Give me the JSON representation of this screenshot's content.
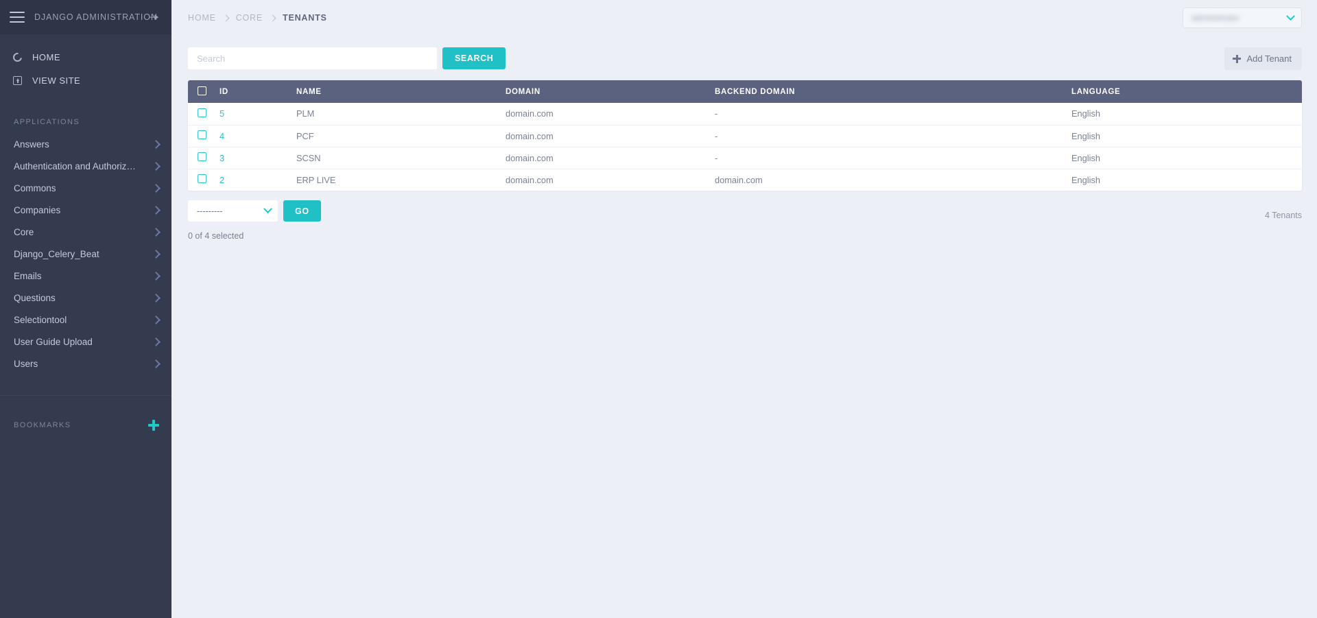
{
  "sidebar": {
    "brand_title": "DJANGO ADMINISTRATION",
    "hamburger_icon": "hamburger-menu-icon",
    "pin_icon": "pin-icon",
    "nav": [
      {
        "label": "HOME",
        "icon": "home-ring-icon"
      },
      {
        "label": "VIEW SITE",
        "icon": "external-link-box-icon"
      }
    ],
    "applications_title": "APPLICATIONS",
    "applications": [
      {
        "label": "Answers"
      },
      {
        "label": "Authentication and Authoriz…"
      },
      {
        "label": "Commons"
      },
      {
        "label": "Companies"
      },
      {
        "label": "Core"
      },
      {
        "label": "Django_Celery_Beat"
      },
      {
        "label": "Emails"
      },
      {
        "label": "Questions"
      },
      {
        "label": "Selectiontool"
      },
      {
        "label": "User Guide Upload"
      },
      {
        "label": "Users"
      }
    ],
    "bookmarks_title": "BOOKMARKS",
    "bookmarks_add_icon": "plus-icon"
  },
  "topbar": {
    "breadcrumb": [
      {
        "label": "HOME",
        "current": false
      },
      {
        "label": "CORE",
        "current": false
      },
      {
        "label": "TENANTS",
        "current": true
      }
    ],
    "user_menu": {
      "label": "",
      "redacted": true,
      "chevron_icon": "chevron-down-icon"
    }
  },
  "toolbar": {
    "search_placeholder": "Search",
    "search_value": "",
    "search_button": "SEARCH",
    "add_button": "Add Tenant",
    "add_icon": "plus-icon"
  },
  "table": {
    "columns": [
      "ID",
      "NAME",
      "DOMAIN",
      "BACKEND DOMAIN",
      "LANGUAGE"
    ],
    "rows": [
      {
        "id": "5",
        "name": "PLM",
        "domain": "domain.com",
        "backend_domain": "-",
        "language": "English"
      },
      {
        "id": "4",
        "name": "PCF",
        "domain": "domain.com",
        "backend_domain": "-",
        "language": "English"
      },
      {
        "id": "3",
        "name": "SCSN",
        "domain": "domain.com",
        "backend_domain": "-",
        "language": "English"
      },
      {
        "id": "2",
        "name": "ERP LIVE",
        "domain": "domain.com",
        "backend_domain": "domain.com",
        "language": "English"
      }
    ]
  },
  "actions": {
    "select_value": "---------",
    "go_button": "GO",
    "selected_text": "0 of 4 selected",
    "count_text": "4 Tenants"
  },
  "colors": {
    "sidebar_bg": "#353b4f",
    "sidebar_brandbar_bg": "#2f3446",
    "accent_teal": "#20c0c7",
    "table_header_bg": "#5b6280",
    "page_bg": "#ecf0f6",
    "chevron_purple": "#6f76ad"
  }
}
